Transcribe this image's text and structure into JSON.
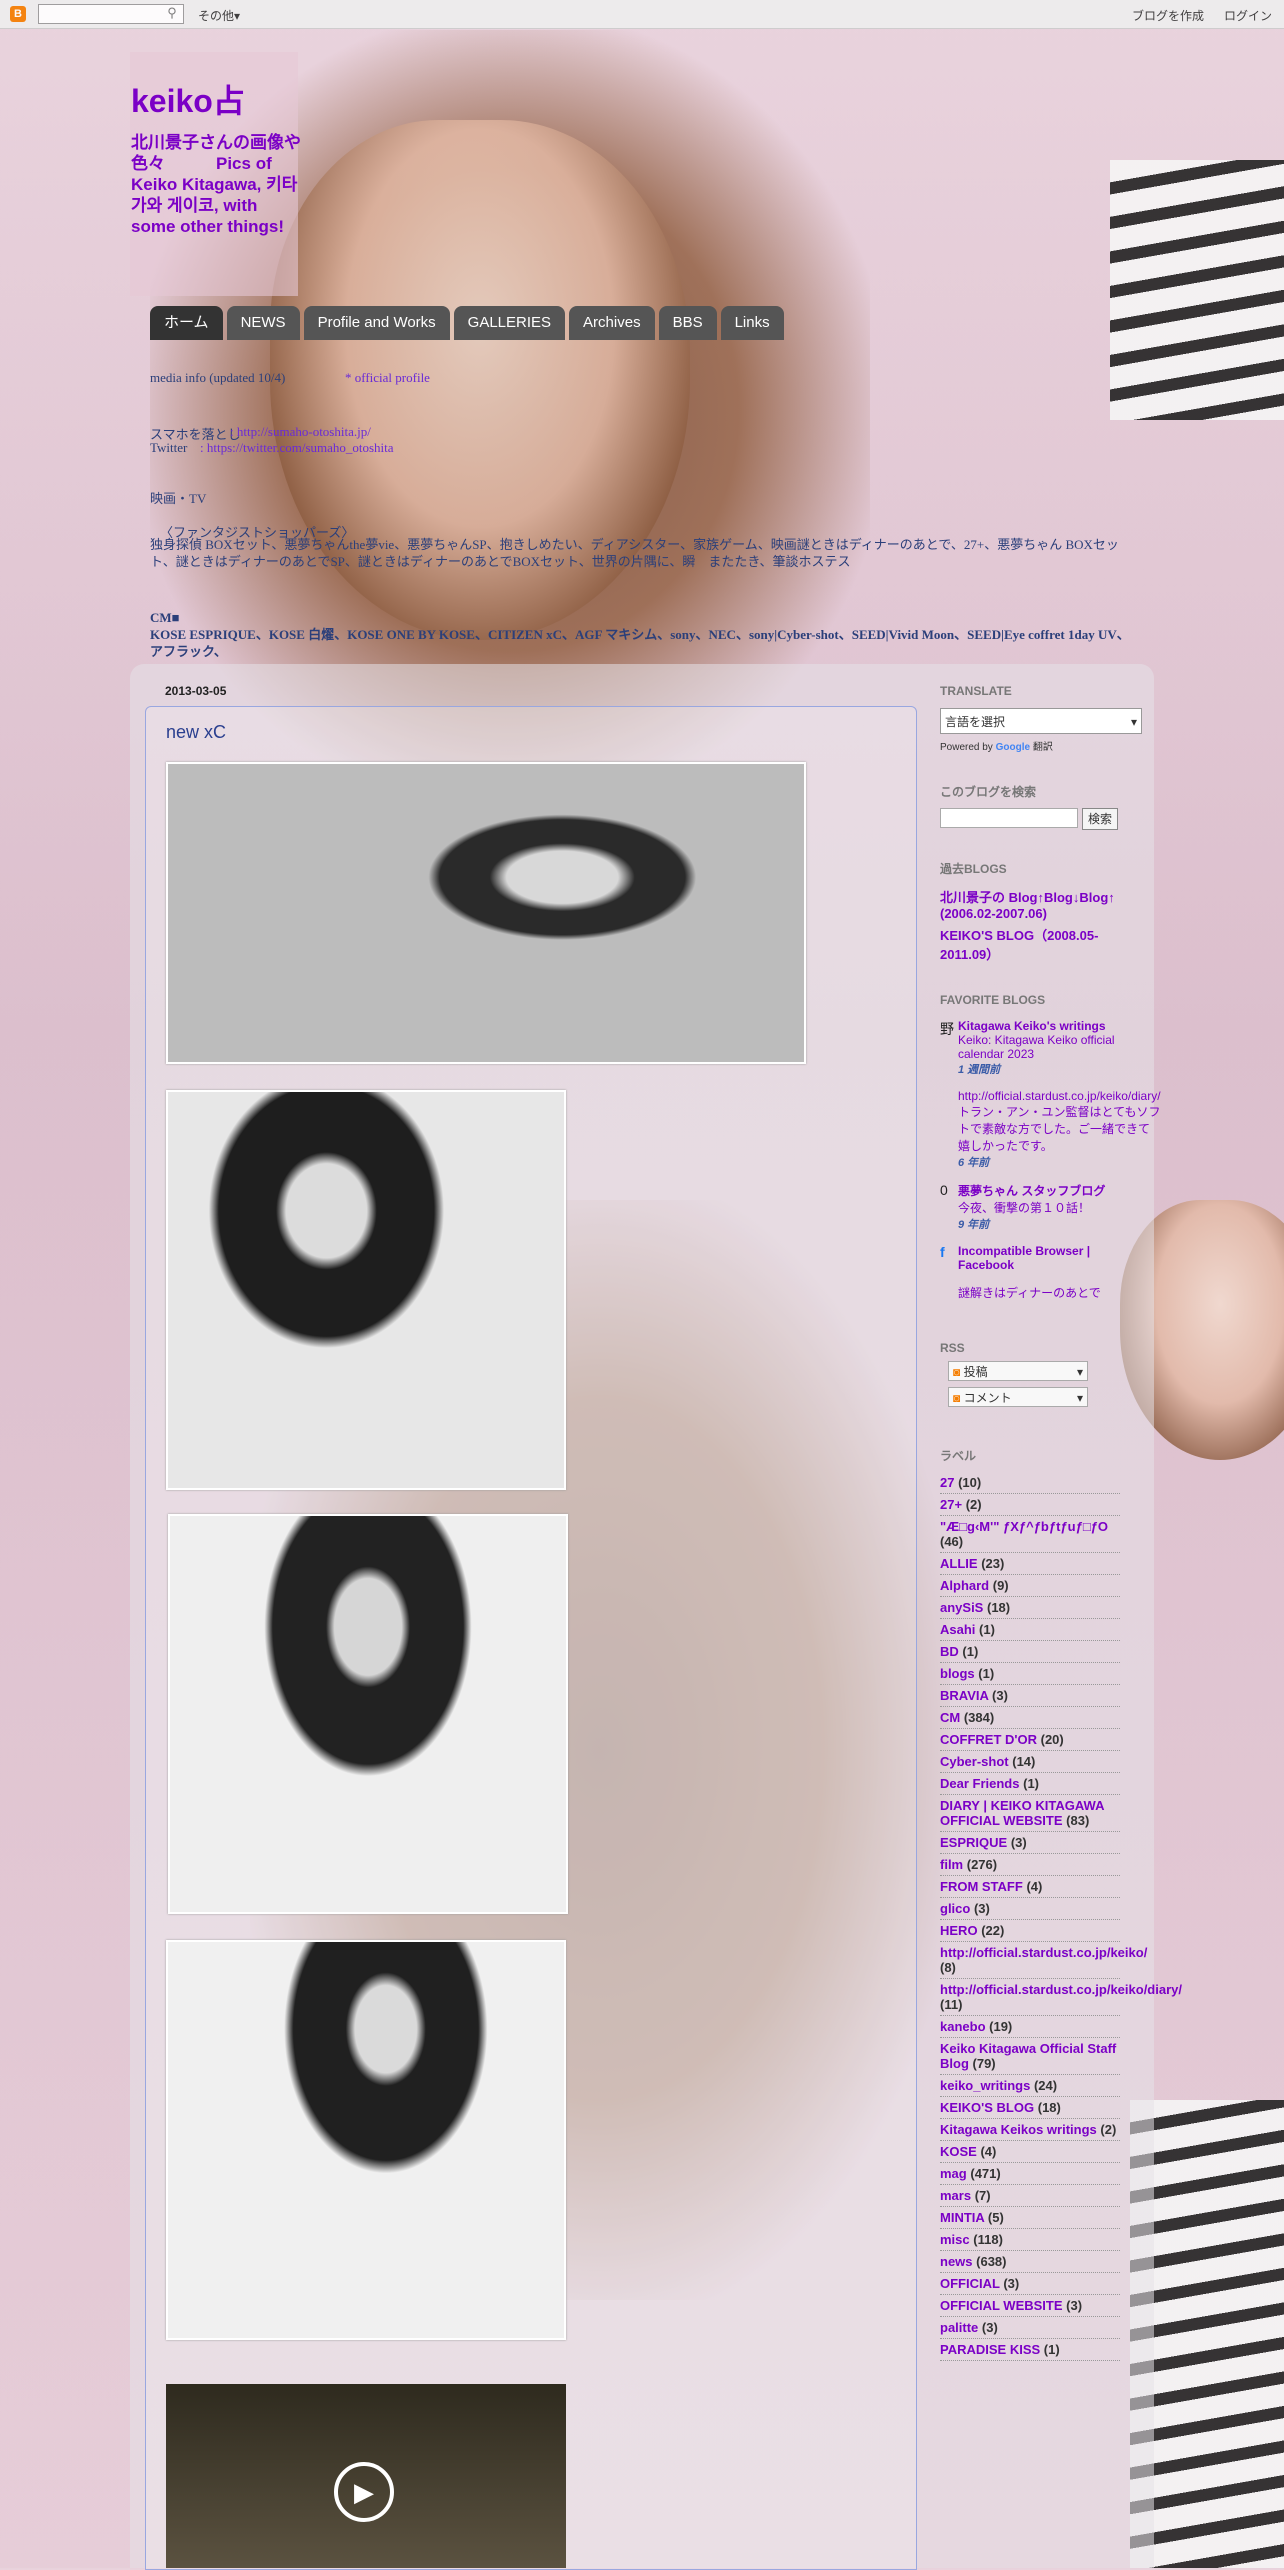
{
  "navbar": {
    "logo": "B",
    "search_icon": "search-icon",
    "more": "その他▾",
    "create_blog": "ブログを作成",
    "login": "ログイン"
  },
  "header": {
    "title": "keiko占",
    "description": "北川景子さんの画像や色々　　　Pics of Keiko Kitagawa, 키타가와 게이코, with some other things!"
  },
  "tabs": [
    "ホーム",
    "NEWS",
    "Profile and Works",
    "GALLERIES",
    "Archives",
    "BBS",
    "Links"
  ],
  "header_links": {
    "line1_a": "media info (updated 10/4)",
    "line1_b": "* official profile",
    "line2_label": "スマホを落とし",
    "line2_url": ": http://sumaho-otoshita.jp/",
    "line3_label": "Twitter",
    "line3_url": ": https://twitter.com/sumaho_otoshita",
    "works_label": "映画・TV",
    "works_sub": "〈ファンタジストショッパーズ〉",
    "works_line1": "独身探偵 BOXセット、悪夢ちゃんthe夢vie、悪夢ちゃんSP、抱きしめたい、ディアシスター、家族ゲーム、映画謎ときはディナーのあとで、27+、悪夢ちゃん BOXセット、謎ときはディナーのあとでSP、謎ときはディナーのあとでBOXセット、世界の片隅に、瞬　またたき、筆談ホステス",
    "cm_label": "CM■",
    "cm_line": "KOSE ESPRIQUE、KOSE 白燿、KOSE ONE BY KOSE、CITIZEN xC、AGF マキシム、sony、NEC、sony|Cyber-shot、SEED|Vivid Moon、SEED|Eye coffret 1day UV、アフラック、"
  },
  "post": {
    "date": "2013-03-05",
    "title": "new xC",
    "video_play": "▶"
  },
  "sidebar": {
    "translate_heading": "TRANSLATE",
    "translate_select": "言語を選択",
    "powered_by": "Powered by",
    "google": "Google",
    "translate_word": "翻訳",
    "search_heading": "このブログを検索",
    "search_button": "検索",
    "past_heading": "過去BLOGS",
    "past_links": [
      "北川景子の Blog↑Blog↓Blog↑ (2006.02-2007.06)",
      "KEIKO'S BLOG（2008.05-2011.09）"
    ],
    "fav_heading": "FAVORITE BLOGS",
    "favorites": [
      {
        "icon": "野",
        "title": "Kitagawa Keiko's writings",
        "sub": "Keiko: Kitagawa Keiko official calendar 2023",
        "time": "1 週間前"
      },
      {
        "icon": "",
        "title": "",
        "sub": "http://official.stardust.co.jp/keiko/diary/ トラン・アン・ユン監督はとてもソフトで素敵な方でした。ご一緒できて嬉しかったです。",
        "time": "6 年前"
      },
      {
        "icon": "0",
        "title": "悪夢ちゃん スタッフブログ",
        "sub": "今夜、衝撃の第１０話！",
        "time": "9 年前"
      },
      {
        "icon": "f",
        "title": "Incompatible Browser | Facebook",
        "sub": "",
        "time": ""
      },
      {
        "icon": "",
        "title": "",
        "sub": "謎解きはディナーのあとで",
        "time": ""
      }
    ],
    "rss_heading": "RSS",
    "rss_posts": "投稿",
    "rss_comments": "コメント",
    "labels_heading": "ラベル",
    "labels": [
      {
        "name": "27",
        "count": "(10)"
      },
      {
        "name": "27+",
        "count": "(2)"
      },
      {
        "name": "\"Æ□g‹M'\" ƒXƒ^ƒbƒtƒuƒ□ƒO",
        "count": "(46)"
      },
      {
        "name": "ALLIE",
        "count": "(23)"
      },
      {
        "name": "Alphard",
        "count": "(9)"
      },
      {
        "name": "anySiS",
        "count": "(18)"
      },
      {
        "name": "Asahi",
        "count": "(1)"
      },
      {
        "name": "BD",
        "count": "(1)"
      },
      {
        "name": "blogs",
        "count": "(1)"
      },
      {
        "name": "BRAVIA",
        "count": "(3)"
      },
      {
        "name": "CM",
        "count": "(384)"
      },
      {
        "name": "COFFRET D'OR",
        "count": "(20)"
      },
      {
        "name": "Cyber-shot",
        "count": "(14)"
      },
      {
        "name": "Dear Friends",
        "count": "(1)"
      },
      {
        "name": "DIARY | KEIKO KITAGAWA OFFICIAL WEBSITE",
        "count": "(83)"
      },
      {
        "name": "ESPRIQUE",
        "count": "(3)"
      },
      {
        "name": "film",
        "count": "(276)"
      },
      {
        "name": "FROM STAFF",
        "count": "(4)"
      },
      {
        "name": "glico",
        "count": "(3)"
      },
      {
        "name": "HERO",
        "count": "(22)"
      },
      {
        "name": "http://official.stardust.co.jp/keiko/",
        "count": "(8)"
      },
      {
        "name": "http://official.stardust.co.jp/keiko/diary/",
        "count": "(11)"
      },
      {
        "name": "kanebo",
        "count": "(19)"
      },
      {
        "name": "Keiko Kitagawa Official Staff Blog",
        "count": "(79)"
      },
      {
        "name": "keiko_writings",
        "count": "(24)"
      },
      {
        "name": "KEIKO'S BLOG",
        "count": "(18)"
      },
      {
        "name": "Kitagawa Keikos writings",
        "count": "(2)"
      },
      {
        "name": "KOSE",
        "count": "(4)"
      },
      {
        "name": "mag",
        "count": "(471)"
      },
      {
        "name": "mars",
        "count": "(7)"
      },
      {
        "name": "MINTIA",
        "count": "(5)"
      },
      {
        "name": "misc",
        "count": "(118)"
      },
      {
        "name": "news",
        "count": "(638)"
      },
      {
        "name": "OFFICIAL",
        "count": "(3)"
      },
      {
        "name": "OFFICIAL WEBSITE",
        "count": "(3)"
      },
      {
        "name": "palitte",
        "count": "(3)"
      },
      {
        "name": "PARADISE KISS",
        "count": "(1)"
      }
    ]
  }
}
